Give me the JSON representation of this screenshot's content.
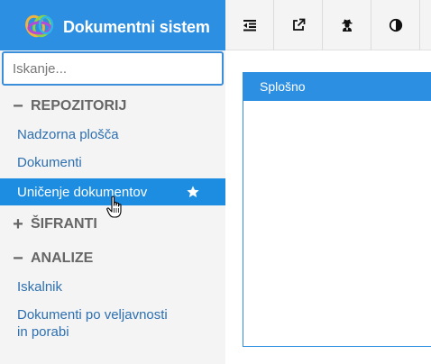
{
  "brand": {
    "title": "Dokumentni sistem",
    "logo_icon": "rings-logo-icon"
  },
  "search": {
    "placeholder": "Iskanje..."
  },
  "nav": {
    "groups": [
      {
        "sign": "−",
        "label": "REPOZITORIJ",
        "items": [
          {
            "label": "Nadzorna plošča"
          },
          {
            "label": "Dokumenti"
          },
          {
            "label": "Uničenje dokumentov",
            "active": true,
            "icon": "star-icon"
          }
        ]
      },
      {
        "sign": "+",
        "label": "ŠIFRANTI"
      },
      {
        "sign": "−",
        "label": "ANALIZE",
        "items": [
          {
            "label": "Iskalnik"
          },
          {
            "label_line1": "Dokumenti po veljavnosti",
            "label_line2": "in porabi"
          }
        ]
      }
    ]
  },
  "toolbar": {
    "buttons": [
      {
        "icon": "outdent-icon"
      },
      {
        "icon": "external-link-icon"
      },
      {
        "icon": "user-secret-icon"
      },
      {
        "icon": "contrast-icon"
      }
    ]
  },
  "panel": {
    "title": "Splošno"
  },
  "colors": {
    "accent": "#2d8fe1",
    "link": "#2d6fb0",
    "sidebar_bg": "#f4f4f4"
  }
}
